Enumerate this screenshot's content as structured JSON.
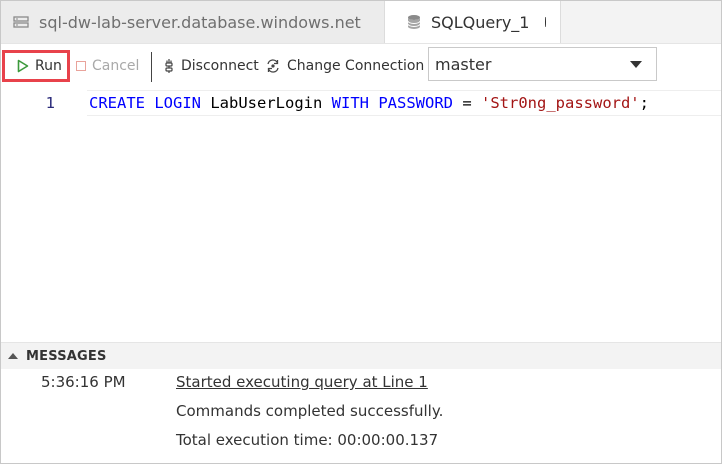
{
  "tabs": [
    {
      "label": "sql-dw-lab-server.database.windows.net",
      "active": false
    },
    {
      "label": "SQLQuery_1",
      "active": true,
      "dirty": true
    }
  ],
  "toolbar": {
    "run_label": "Run",
    "cancel_label": "Cancel",
    "disconnect_label": "Disconnect",
    "change_connection_label": "Change Connection",
    "database_selected": "master",
    "highlight_color": "#e8424b"
  },
  "editor": {
    "line_number": "1",
    "tokens": {
      "t1": "CREATE",
      "t2": " ",
      "t3": "LOGIN",
      "t4": " LabUserLogin ",
      "t5": "WITH",
      "t6": " ",
      "t7": "PASSWORD",
      "t8": " = ",
      "t9": "'Str0ng_password'",
      "t10": ";"
    }
  },
  "messages": {
    "header": "MESSAGES",
    "rows": [
      {
        "time": "5:36:16 PM",
        "text": "Started executing query at Line 1"
      },
      {
        "time": "",
        "text": "Commands completed successfully."
      },
      {
        "time": "",
        "text": "Total execution time: 00:00:00.137"
      }
    ]
  },
  "icons": {
    "server_tab": "server-icon",
    "query_tab": "database-icon",
    "run": "play-icon",
    "cancel": "stop-icon",
    "disconnect": "disconnect-plug-icon",
    "change_connection": "change-connection-icon",
    "dropdown": "chevron-down-icon",
    "messages_toggle": "collapse-triangle-icon"
  }
}
